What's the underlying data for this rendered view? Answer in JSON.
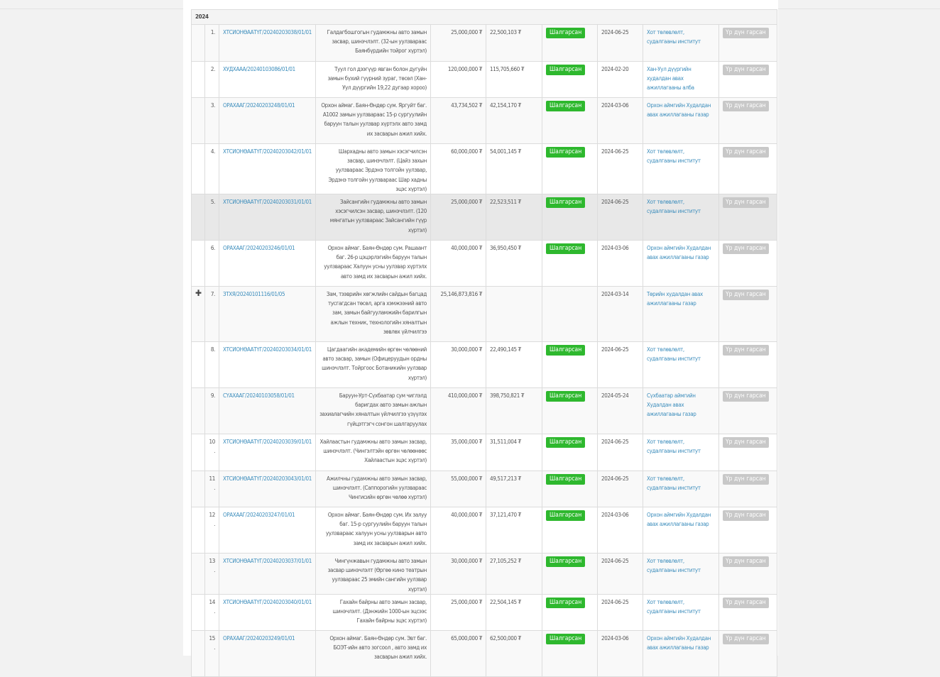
{
  "year": "2024",
  "result_label": "Үр дүн гарсан",
  "status_label": "Шалгарсан",
  "expand_symbol": "✚",
  "rows": [
    {
      "num": "1.",
      "id": "ХТСИОНӨААТҮГ/20240203038/01/01",
      "desc": "Галдагбошгогын гудамжны авто замын засвар, шинэчлэлт. (32-ын уулзвараас Баянбүрдийн тойрог хүртэл)",
      "budget": "25,000,000 ₮",
      "bid": "22,500,103 ₮",
      "status": "Шалгарсан",
      "date": "2024-06-25",
      "org": "Хот төлөвлөлт, судалгааны институт"
    },
    {
      "num": "2.",
      "id": "ХУДХААА/20240103086/01/01",
      "desc": "Туул гол дээгүүр явган болон дугуйн замын бүхий гүүрний зураг, төсөл (Хан-Уул дүүргийн 19,22 дугаар хороо)",
      "budget": "120,000,000 ₮",
      "bid": "115,705,660 ₮",
      "status": "Шалгарсан",
      "date": "2024-02-20",
      "org": "Хан-Уул дүүргийн худалдан авах ажиллагааны алба"
    },
    {
      "num": "3.",
      "id": "ОРАХААГ/20240203248/01/01",
      "desc": "Орхон аймаг. Баян-Өндөр сум. Яргуйт баг. А1002 замын уулзвараас 15-р сургуулийн баруун талын уулзвар хүртэлх авто замд их засварын ажил хийх.",
      "budget": "43,734,502 ₮",
      "bid": "42,154,170 ₮",
      "status": "Шалгарсан",
      "date": "2024-03-06",
      "org": "Орхон аймгийн Худалдан авах ажиллагааны газар"
    },
    {
      "num": "4.",
      "id": "ХТСИОНӨААТҮГ/20240203042/01/01",
      "desc": "Шархадны авто замын хэсэгчилсэн засвар, шинэчлэлт. (Цайз захын уулзвараас Эрдэнэ толгойн уулзвар, Эрдэнэ толгойн уулзвараас Шар хадны эцэс хүртэл)",
      "budget": "60,000,000 ₮",
      "bid": "54,001,145 ₮",
      "status": "Шалгарсан",
      "date": "2024-06-25",
      "org": "Хот төлөвлөлт, судалгааны институт"
    },
    {
      "num": "5.",
      "id": "ХТСИОНӨААТҮГ/20240203031/01/01",
      "desc": "Зайсангийн гудамжны авто замын хэсэгчилсэн засвар, шинэчлэлт. (120 мянгатын уулзвараас Зайсангийн гүүр хүртэл)",
      "budget": "25,000,000 ₮",
      "bid": "22,523,511 ₮",
      "status": "Шалгарсан",
      "date": "2024-06-25",
      "org": "Хот төлөвлөлт, судалгааны институт"
    },
    {
      "num": "6.",
      "id": "ОРАХААГ/20240203246/01/01",
      "desc": "Орхон аймаг. Баян-Өндөр сум. Рашаант баг. 26-р цэцэрлэгийн баруун талын уулзвараас Халуун усны уулзвар хүртэлх авто замд их засварын ажил хийх.",
      "budget": "40,000,000 ₮",
      "bid": "36,950,450 ₮",
      "status": "Шалгарсан",
      "date": "2024-03-06",
      "org": "Орхон аймгийн Худалдан авах ажиллагааны газар"
    },
    {
      "num": "7.",
      "id": "ЗТХЯ/20240101116/01/05",
      "desc": "Зам, тээврийн хөгжлийн сайдын багцад тусгагдсан төсөл, арга хэмжээний авто зам, замын байгууламжийн барилгын ажлын техник, технологийн хяналтын зөвлөх үйлчилгээ",
      "budget": "25,146,873,816 ₮",
      "bid": "",
      "status": "",
      "date": "2024-03-14",
      "org": "Төрийн худалдан авах ажиллагааны газар",
      "expandable": true
    },
    {
      "num": "8.",
      "id": "ХТСИОНӨААТҮГ/20240203034/01/01",
      "desc": "Цагдаагийн академийн өргөн чөлөөний авто засвар, замын (Офицеруудын ордны шинэчлэлт. Тойргоос Ботаникийн уулзвар хүртэл)",
      "budget": "30,000,000 ₮",
      "bid": "22,490,145 ₮",
      "status": "Шалгарсан",
      "date": "2024-06-25",
      "org": "Хот төлөвлөлт, судалгааны институт"
    },
    {
      "num": "9.",
      "id": "СҮАХААГ/20240103058/01/01",
      "desc": "Баруун-Урт-Сүхбаатар сум чиглэлд баригдах авто замын ажлын захиалагчийн хяналтын үйлчилгээ үзүүлэх гүйцэтгэгч сонгон шалгаруулах",
      "budget": "410,000,000 ₮",
      "bid": "398,750,821 ₮",
      "status": "Шалгарсан",
      "date": "2024-05-24",
      "org": "Сүхбаатар аймгийн Худалдан авах ажиллагааны газар"
    },
    {
      "num": "10.",
      "id": "ХТСИОНӨААТҮГ/20240203039/01/01",
      "desc": "Хайлаастын гудамжны авто замын засвар, шинэчлэлт. (Чингэлтэйн өргөн чөлөөнөөс Хайлаастын эцэс хүртэл)",
      "budget": "35,000,000 ₮",
      "bid": "31,511,004 ₮",
      "status": "Шалгарсан",
      "date": "2024-06-25",
      "org": "Хот төлөвлөлт, судалгааны институт"
    },
    {
      "num": "11.",
      "id": "ХТСИОНӨААТҮГ/20240203043/01/01",
      "desc": "Ажилчны гудамжны авто замын засвар, шинэчлэлт. (Саппорогийн уулзвараас Чингисийн өргөн чөлөө хүртэл)",
      "budget": "55,000,000 ₮",
      "bid": "49,517,213 ₮",
      "status": "Шалгарсан",
      "date": "2024-06-25",
      "org": "Хот төлөвлөлт, судалгааны институт"
    },
    {
      "num": "12.",
      "id": "ОРАХААГ/20240203247/01/01",
      "desc": "Орхон аймаг. Баян-Өндөр сум. Их залуу баг. 15-р сургуулийн баруун талын уулзвараас халуун усны уулзварын авто замд их засварын ажил хийх.",
      "budget": "40,000,000 ₮",
      "bid": "37,121,470 ₮",
      "status": "Шалгарсан",
      "date": "2024-03-06",
      "org": "Орхон аймгийн Худалдан авах ажиллагааны газар"
    },
    {
      "num": "13.",
      "id": "ХТСИОНӨААТҮГ/20240203037/01/01",
      "desc": "Чингүнжавын гудамжны авто замын засвар шинэчлэлт (Өргөө кино театрын уулзвараас 25 эмийн сангийн уулзвар хүртэл)",
      "budget": "30,000,000 ₮",
      "bid": "27,105,252 ₮",
      "status": "Шалгарсан",
      "date": "2024-06-25",
      "org": "Хот төлөвлөлт, судалгааны институт"
    },
    {
      "num": "14.",
      "id": "ХТСИОНӨААТҮГ/20240203040/01/01",
      "desc": "Гахайн байрны авто замын засвар, шинэчлэлт. (Дэнжийн 1000-ын эцсээс Гахайн байрны эцэс хүртэл)",
      "budget": "25,000,000 ₮",
      "bid": "22,504,145 ₮",
      "status": "Шалгарсан",
      "date": "2024-06-25",
      "org": "Хот төлөвлөлт, судалгааны институт"
    },
    {
      "num": "15.",
      "id": "ОРАХААГ/20240203249/01/01",
      "desc": "Орхон аймаг. Баян-Өндөр сум. Эвт баг. БОЭТ-ийн авто зогсоол , авто замд их засварын ажил хийх.",
      "budget": "65,000,000 ₮",
      "bid": "62,500,000 ₮",
      "status": "Шалгарсан",
      "date": "2024-03-06",
      "org": "Орхон аймгийн Худалдан авах ажиллагааны газар"
    }
  ]
}
